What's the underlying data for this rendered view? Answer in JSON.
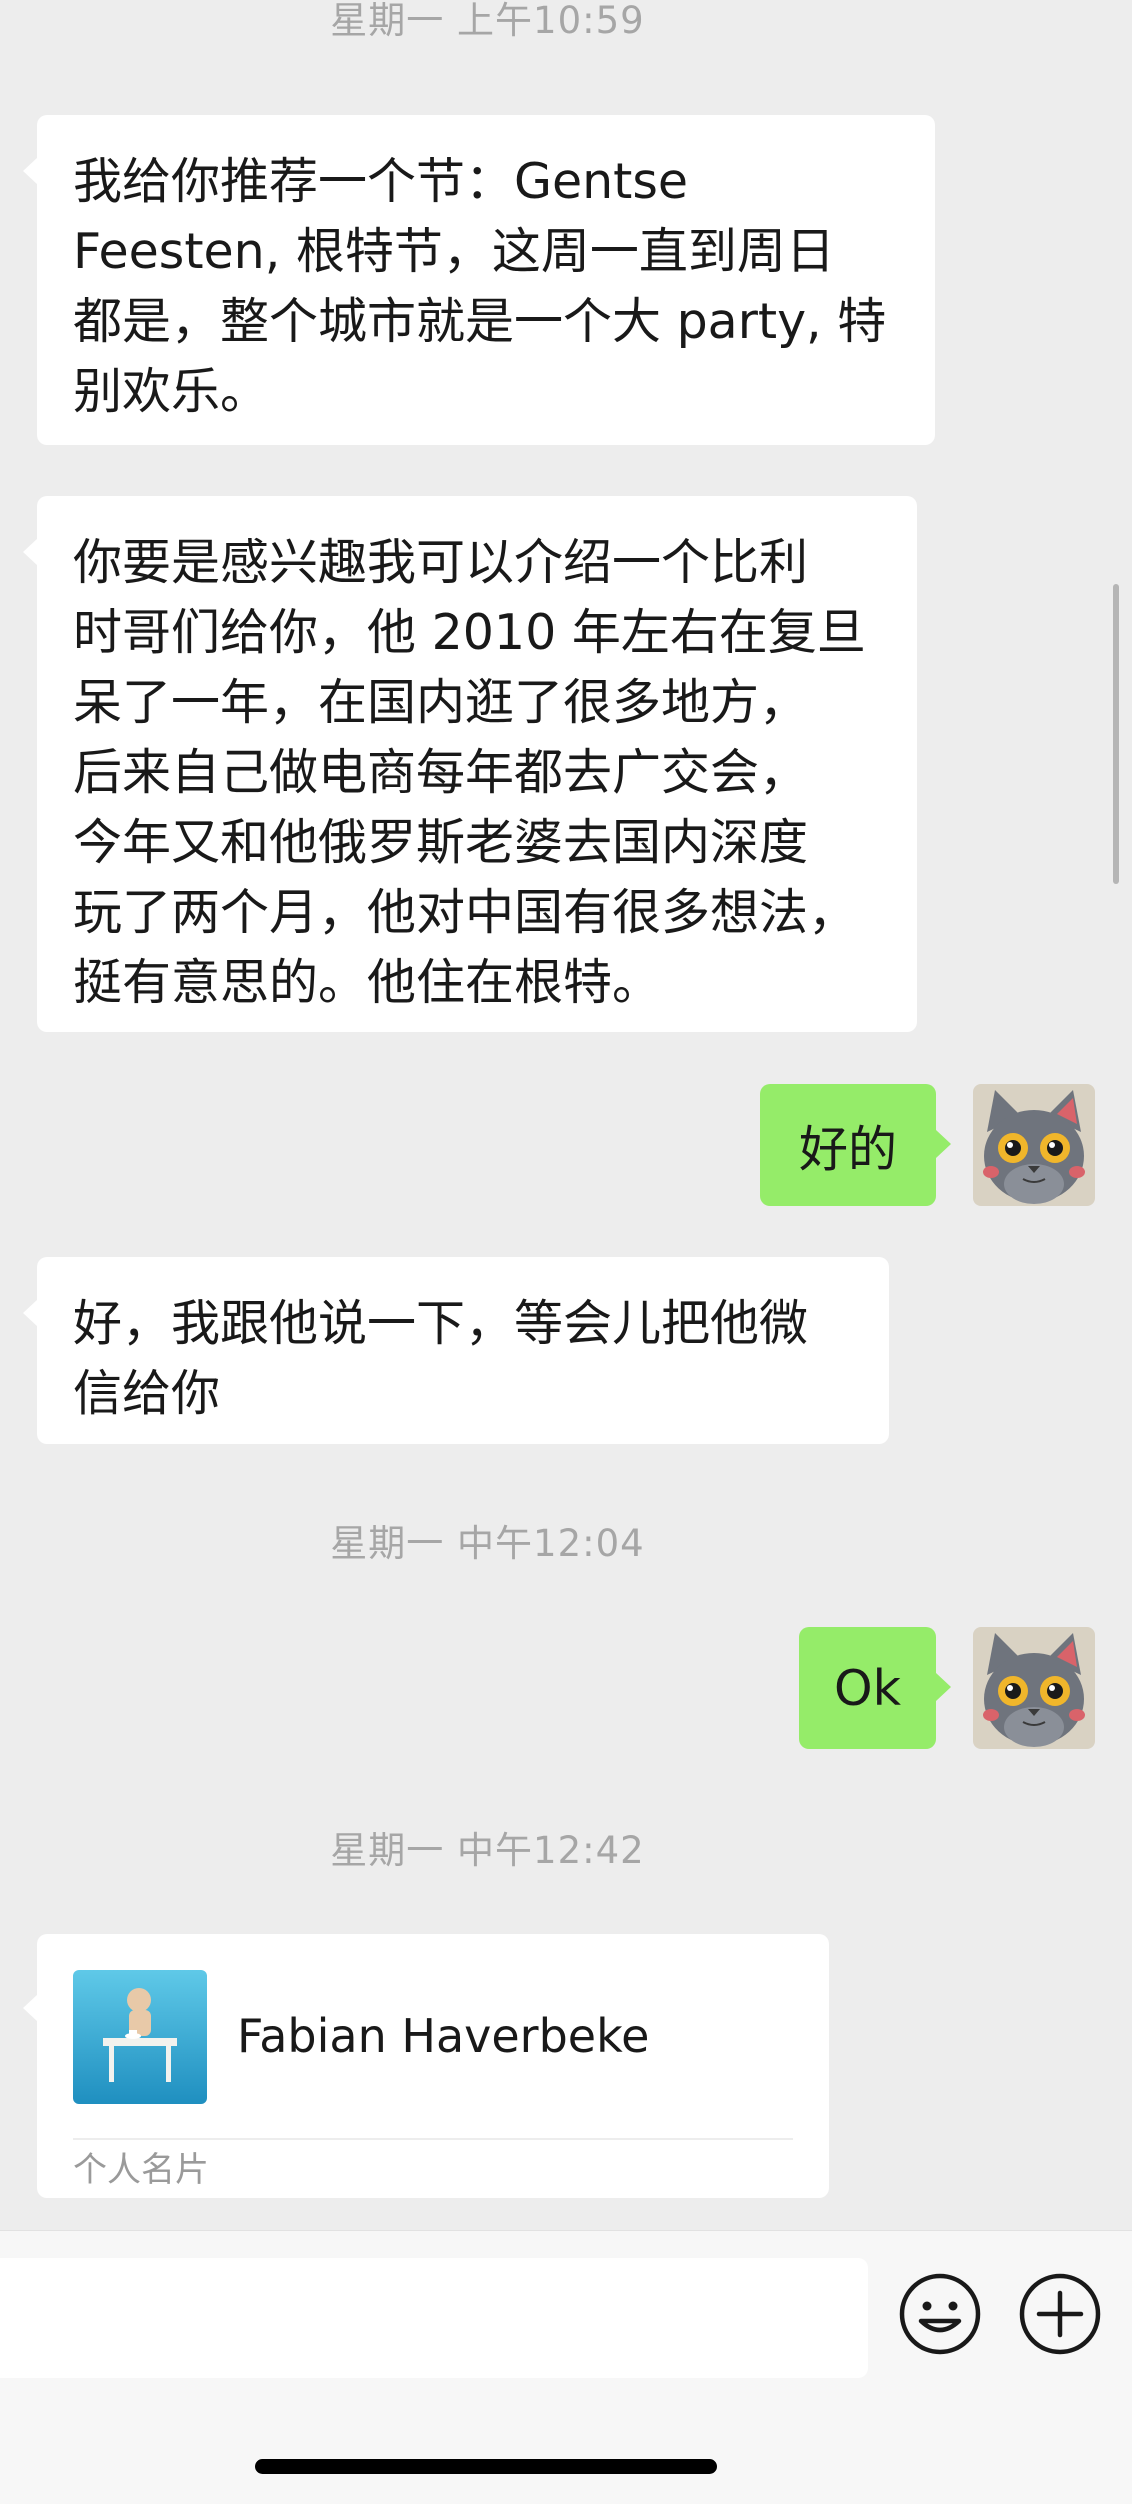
{
  "chat": {
    "timestamps": [
      "星期一 上午10:59",
      "星期一 中午12:04",
      "星期一 中午12:42"
    ],
    "messages": [
      {
        "from": "contact",
        "text": "我给你推荐一个节：Gentse\nFeesten, 根特节，这周一直到周日\n都是，整个城市就是一个大 party, 特\n别欢乐。"
      },
      {
        "from": "contact",
        "text": "你要是感兴趣我可以介绍一个比利\n时哥们给你，他 2010 年左右在复旦\n呆了一年，在国内逛了很多地方，\n后来自己做电商每年都去广交会，\n今年又和他俄罗斯老婆去国内深度\n玩了两个月，他对中国有很多想法，\n挺有意思的。他住在根特。"
      },
      {
        "from": "me",
        "text": "好的"
      },
      {
        "from": "contact",
        "text": "好，我跟他说一下，等会儿把他微\n信给你"
      },
      {
        "from": "me",
        "text": "Ok"
      }
    ],
    "contact_card": {
      "name": "Fabian Haverbeke",
      "label": "个人名片"
    }
  },
  "input_bar": {
    "message_value": "",
    "emoji_icon": "emoji-icon",
    "plus_icon": "plus-circle-icon"
  },
  "colors": {
    "background": "#ededed",
    "incoming_bubble": "#ffffff",
    "outgoing_bubble": "#95ec69",
    "timestamp_text": "#a6a6a6"
  }
}
